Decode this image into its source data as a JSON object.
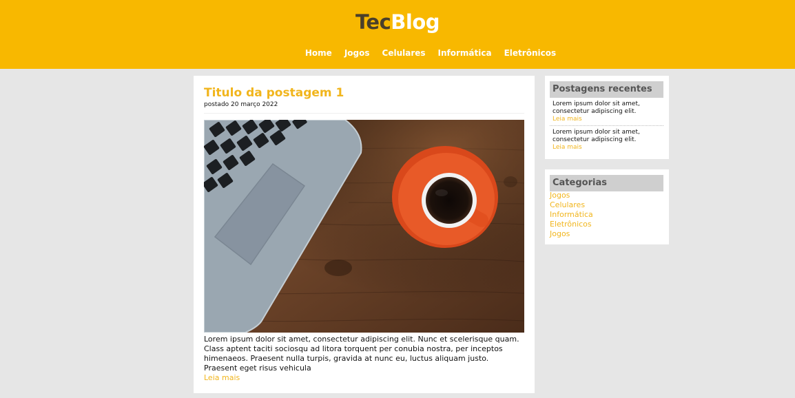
{
  "site": {
    "logo_part1": "Tec",
    "logo_part2": "Blog",
    "nav": [
      "Home",
      "Jogos",
      "Celulares",
      "Informática",
      "Eletrônicos"
    ]
  },
  "post": {
    "title": "Titulo da postagem 1",
    "date": "postado 20 março 2022",
    "body": "Lorem ipsum dolor sit amet, consectetur adipiscing elit. Nunc et scelerisque quam. Class aptent taciti sociosqu ad litora torquent per conubia nostra, per inceptos himenaeos. Praesent nulla turpis, gravida at nunc eu, luctus aliquam justo. Praesent eget risus vehicula",
    "read_more": "Leia mais"
  },
  "recent": {
    "title": "Postagens recentes",
    "items": [
      {
        "text": "Lorem ipsum dolor sit amet, consectetur adipiscing elit.",
        "more": "Leia mais"
      },
      {
        "text": "Lorem ipsum dolor sit amet, consectetur adipiscing elit.",
        "more": "Leia mais"
      }
    ]
  },
  "categories": {
    "title": "Categorias",
    "items": [
      "Jogos",
      "Celulares",
      "Informática",
      "Eletrônicos",
      "Jogos"
    ]
  },
  "colors": {
    "header_bg": "#f8b800",
    "accent": "#f1b51c",
    "logo_dark": "#4a3f2a",
    "page_bg": "#e6e6e6"
  }
}
